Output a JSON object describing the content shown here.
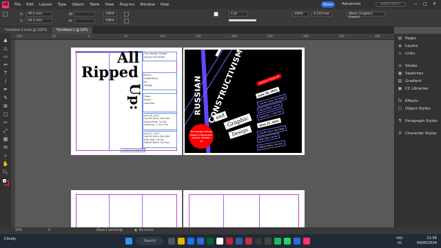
{
  "menubar": {
    "logo": "Id",
    "items": [
      "File",
      "Edit",
      "Layout",
      "Type",
      "Object",
      "Table",
      "View",
      "Plug-ins",
      "Window",
      "Help"
    ],
    "share": "Share",
    "workspace": "Advanced",
    "search_placeholder": "Adobe Stock",
    "window_controls": [
      "—",
      "□",
      "✕"
    ]
  },
  "control": {
    "x_label": "X:",
    "x_value": "95.5 mm",
    "y_label": "Y:",
    "y_value": "91.2 mm",
    "w_label": "W:",
    "h_label": "H:",
    "stroke_weight": "1 pt",
    "percent": "100%",
    "dimension": "4.233 mm",
    "style": "[Basic Graphics Frame]"
  },
  "tabs": [
    {
      "label": "*Untitled-3.indd @ 100%",
      "active": false
    },
    {
      "label": "*Untitled-1 @ 50%",
      "active": true
    }
  ],
  "ruler": {
    "ticks": [
      "100",
      "50",
      "0",
      "50",
      "100",
      "150",
      "200",
      "250",
      "300",
      "350",
      "400"
    ]
  },
  "page_left": {
    "title_all": "All",
    "title_ripped": "Ripped",
    "title_up": "Up:",
    "school_header": "The Design School\nSaylor University",
    "event_block": "Event\nCollections\nfor\nDesign",
    "open_block": "Open\nPublic\nLectures",
    "dates_one": "June 26, 2021\nLise Mc Guire, San Diet\nAlexis Elliott, Cal Gal\nSalesman, 1 Line One",
    "dates_two": "June 27, 2021\nLise Mc Guire, San Diet\nEllen Rett, Cal Gal\nMikhail Alfaro, San Ann",
    "footer": "Lecture Theatre 10"
  },
  "page_right": {
    "russian": "RUSSIAN",
    "constructivism": "CONSTRUCTIVISM",
    "and": "and",
    "graphic": "Graphic",
    "design": "Design",
    "circle_text": "The Design School\nSaylor's University\nLecture Theatre 10",
    "tag_lecture": "Lecture Times 10",
    "tags": [
      "June 26, 2021",
      "Lise Mc Guire, San Diego",
      "Alexis Elliott, Cal Gal",
      "Salesman, 1 Line One",
      "June 27, 2021",
      "Lise Mc Guire, San Diego",
      "Ellen Rett, Cal Gal",
      "Mikhail Alfaro, San Ann"
    ]
  },
  "panels": [
    {
      "icon": "pages-icon",
      "glyph": "▤",
      "label": "Pages"
    },
    {
      "icon": "layers-icon",
      "glyph": "◈",
      "label": "Layers"
    },
    {
      "icon": "links-icon",
      "glyph": "∞",
      "label": "Links"
    },
    {
      "icon": "stroke-icon",
      "glyph": "≡",
      "label": "Stroke"
    },
    {
      "icon": "swatches-icon",
      "glyph": "▦",
      "label": "Swatches"
    },
    {
      "icon": "gradient-icon",
      "glyph": "▧",
      "label": "Gradient"
    },
    {
      "icon": "cc-libraries-icon",
      "glyph": "▣",
      "label": "CC Libraries"
    },
    {
      "icon": "effects-icon",
      "glyph": "fx",
      "label": "Effects"
    },
    {
      "icon": "object-styles-icon",
      "glyph": "□",
      "label": "Object Styles"
    },
    {
      "icon": "paragraph-styles-icon",
      "glyph": "¶",
      "label": "Paragraph Styles"
    },
    {
      "icon": "character-styles-icon",
      "glyph": "A",
      "label": "Character Styles"
    }
  ],
  "status": {
    "zoom": "50%",
    "page": "2",
    "style": "[Basic] (working)",
    "errors": "No errors"
  },
  "taskbar": {
    "weather": "Cloudy",
    "search": "Search",
    "lang_top": "ENG",
    "lang_bottom": "US",
    "time": "21:58",
    "date": "04/05/2024"
  },
  "colors": {
    "accent_share": "#2a6ce0",
    "indesign_pink": "#ff3366",
    "circle_red": "#ff0000",
    "guide_magenta": "#c040c0",
    "guide_blue": "#6f8fe0"
  }
}
